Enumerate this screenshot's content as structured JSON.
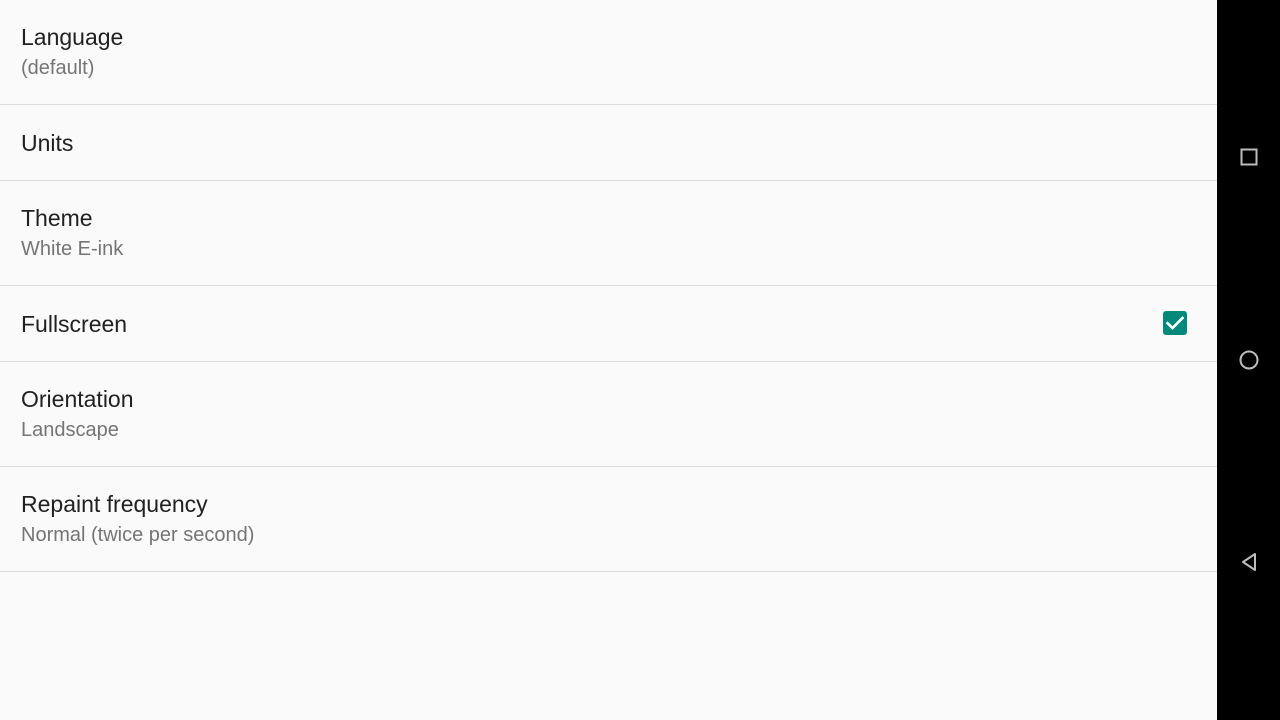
{
  "colors": {
    "accent": "#00897b",
    "background": "#fafafa",
    "title_text": "#212121",
    "summary_text": "#757575",
    "navbar": "#000000",
    "nav_icon": "#bdbdbd"
  },
  "settings": {
    "language": {
      "title": "Language",
      "summary": "(default)"
    },
    "units": {
      "title": "Units"
    },
    "theme": {
      "title": "Theme",
      "summary": "White E-ink"
    },
    "fullscreen": {
      "title": "Fullscreen",
      "checked": true
    },
    "orientation": {
      "title": "Orientation",
      "summary": "Landscape"
    },
    "repaint": {
      "title": "Repaint frequency",
      "summary": "Normal (twice per second)"
    }
  },
  "navbar": {
    "icons": [
      "recents-icon",
      "home-icon",
      "back-icon"
    ]
  }
}
